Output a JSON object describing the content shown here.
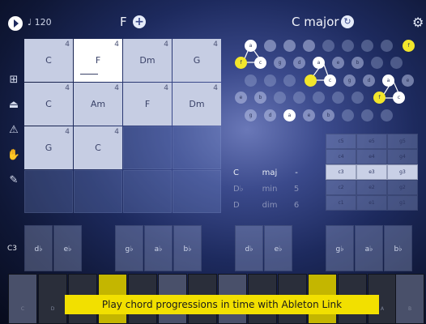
{
  "topbar": {
    "tempo": "♩ 120",
    "key": "F",
    "add_symbol": "+",
    "scale": "C major",
    "scale_btn_symbol": "↻",
    "settings_symbol": "⚙"
  },
  "sidebar": {
    "icons": [
      {
        "name": "grid-icon",
        "glyph": "⊞"
      },
      {
        "name": "metronome-icon",
        "glyph": "⏏"
      },
      {
        "name": "warning-icon",
        "glyph": "⚠"
      },
      {
        "name": "hand-icon",
        "glyph": "✋"
      },
      {
        "name": "edit-icon",
        "glyph": "✎"
      }
    ]
  },
  "grid": {
    "cells": [
      {
        "chord": "C",
        "beats": "4"
      },
      {
        "chord": "F",
        "beats": "4"
      },
      {
        "chord": "Dm",
        "beats": "4"
      },
      {
        "chord": "G",
        "beats": "4"
      },
      {
        "chord": "C",
        "beats": "4"
      },
      {
        "chord": "Am",
        "beats": "4"
      },
      {
        "chord": "F",
        "beats": "4"
      },
      {
        "chord": "Dm",
        "beats": "4"
      },
      {
        "chord": "G",
        "beats": "4"
      },
      {
        "chord": "C",
        "beats": "4"
      }
    ]
  },
  "circle": {
    "row1": [
      "a",
      "",
      "",
      "",
      "",
      "",
      "",
      "",
      "",
      "f"
    ],
    "row2": [
      "f",
      "c",
      "g",
      "d",
      "a",
      "e",
      "b",
      "",
      ""
    ],
    "row3": [
      "",
      "",
      "",
      "",
      "c",
      "g",
      "d",
      "a",
      "e"
    ],
    "row4": [
      "e",
      "b",
      "",
      "",
      "",
      "",
      "",
      "f",
      "c"
    ],
    "row5": [
      "g",
      "d",
      "a",
      "e",
      "b",
      "",
      "",
      ""
    ]
  },
  "roots": {
    "rows": [
      {
        "root": "C",
        "quality": "maj",
        "num": "-"
      },
      {
        "root": "D♭",
        "quality": "min",
        "num": "5"
      },
      {
        "root": "D",
        "quality": "dim",
        "num": "6"
      }
    ]
  },
  "octaves": {
    "cols": [
      [
        "c5",
        "c4",
        "c3",
        "c2",
        "c1"
      ],
      [
        "e5",
        "e4",
        "e3",
        "e2",
        "e1"
      ],
      [
        "g5",
        "g4",
        "g3",
        "g2",
        "g1"
      ]
    ]
  },
  "keyboard": {
    "octave": "C3",
    "black_keys": [
      "d♭",
      "e♭",
      "g♭",
      "a♭",
      "b♭",
      "d♭",
      "e♭",
      "g♭",
      "a♭",
      "b♭"
    ],
    "white_keys": [
      "C",
      "D",
      "E",
      "F",
      "G",
      "A",
      "B",
      "C",
      "D",
      "E",
      "F",
      "G",
      "A",
      "B"
    ]
  },
  "caption": "Play chord progressions in time with Ableton Link",
  "colors": {
    "accent": "#f2e62b",
    "background": "#1d2a5e",
    "cell": "#c6cde3"
  }
}
